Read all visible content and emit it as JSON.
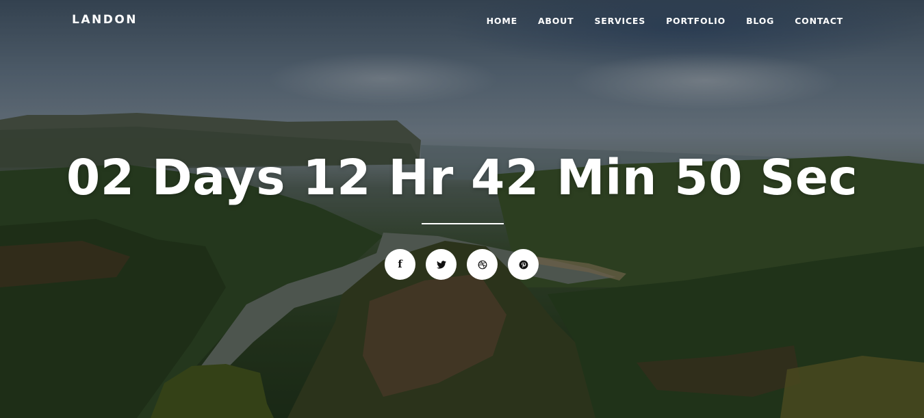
{
  "brand": {
    "logo": "LANDON"
  },
  "nav": {
    "items": [
      {
        "label": "HOME"
      },
      {
        "label": "ABOUT"
      },
      {
        "label": "SERVICES"
      },
      {
        "label": "PORTFOLIO"
      },
      {
        "label": "BLOG"
      },
      {
        "label": "CONTACT"
      }
    ]
  },
  "countdown": {
    "days_value": "02",
    "days_unit": "Days",
    "hours_value": "12",
    "hours_unit": "Hr",
    "minutes_value": "42",
    "minutes_unit": "Min",
    "seconds_value": "50",
    "seconds_unit": "Sec"
  },
  "social": {
    "icons": [
      "facebook-icon",
      "twitter-icon",
      "dribbble-icon",
      "pinterest-icon"
    ],
    "facebook_glyph": "f"
  },
  "colors": {
    "text": "#ffffff",
    "icon_bg": "#ffffff",
    "icon_fg": "#111111"
  }
}
